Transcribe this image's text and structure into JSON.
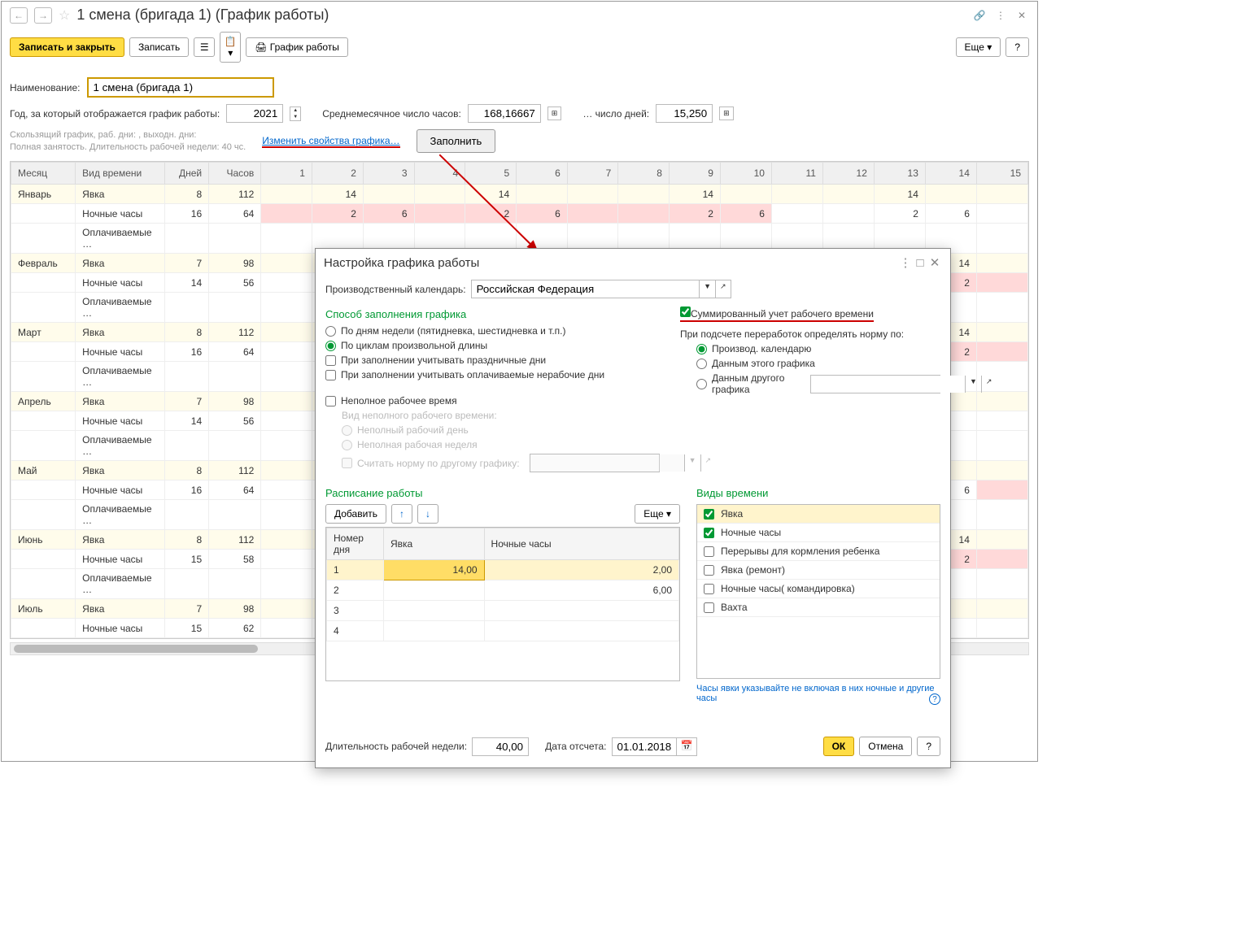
{
  "window": {
    "title": "1 смена (бригада 1) (График работы)",
    "buttons": {
      "save_close": "Записать и закрыть",
      "save": "Записать",
      "schedule": "График работы",
      "more": "Еще",
      "help": "?"
    }
  },
  "form": {
    "name_label": "Наименование:",
    "name_value": "1 смена (бригада 1)",
    "year_label": "Год, за который отображается график работы:",
    "year_value": "2021",
    "avg_hours_label": "Среднемесячное число часов:",
    "avg_hours_value": "168,16667",
    "avg_days_label": "… число дней:",
    "avg_days_value": "15,250",
    "info_line1": "Скользящий график, раб. дни: , выходн. дни:",
    "info_line2": "Полная занятость. Длительность рабочей недели: 40 чс.",
    "change_link": "Изменить свойства графика…",
    "fill_btn": "Заполнить"
  },
  "table": {
    "headers": {
      "month": "Месяц",
      "vid": "Вид времени",
      "dney": "Дней",
      "chasov": "Часов"
    },
    "days": [
      "1",
      "2",
      "3",
      "4",
      "5",
      "6",
      "7",
      "8",
      "9",
      "10",
      "11",
      "12",
      "13",
      "14",
      "15"
    ],
    "rows": [
      {
        "month": "Январь",
        "vid": "Явка",
        "dney": "8",
        "chasov": "112",
        "cells": {
          "2": "14",
          "5": "14",
          "9": "14",
          "13": "14"
        },
        "yellow": [
          "1",
          "2",
          "3",
          "4",
          "5",
          "6",
          "7",
          "8",
          "9",
          "10",
          "15"
        ],
        "isMonth": true,
        "pink": []
      },
      {
        "month": "",
        "vid": "Ночные часы",
        "dney": "16",
        "chasov": "64",
        "cells": {
          "2": "2",
          "3": "6",
          "5": "2",
          "6": "6",
          "9": "2",
          "10": "6",
          "13": "2",
          "14": "6"
        },
        "pink": [
          "1",
          "2",
          "3",
          "4",
          "5",
          "6",
          "7",
          "8",
          "9",
          "10"
        ],
        "yellow": []
      },
      {
        "month": "",
        "vid": "Оплачиваемые …",
        "dney": "",
        "chasov": "",
        "cells": {},
        "pink": [],
        "yellow": []
      },
      {
        "month": "Февраль",
        "vid": "Явка",
        "dney": "7",
        "chasov": "98",
        "cells": {
          "14": "14"
        },
        "yellow": [
          "14",
          "15"
        ],
        "isMonth": true,
        "pink": []
      },
      {
        "month": "",
        "vid": "Ночные часы",
        "dney": "14",
        "chasov": "56",
        "cells": {
          "14": "2"
        },
        "pink": [
          "14",
          "15"
        ],
        "yellow": []
      },
      {
        "month": "",
        "vid": "Оплачиваемые …",
        "dney": "",
        "chasov": "",
        "cells": {},
        "pink": [],
        "yellow": []
      },
      {
        "month": "Март",
        "vid": "Явка",
        "dney": "8",
        "chasov": "112",
        "cells": {
          "14": "14"
        },
        "yellow": [
          "14",
          "15"
        ],
        "isMonth": true,
        "pink": []
      },
      {
        "month": "",
        "vid": "Ночные часы",
        "dney": "16",
        "chasov": "64",
        "cells": {
          "14": "2"
        },
        "pink": [
          "14",
          "15"
        ],
        "yellow": []
      },
      {
        "month": "",
        "vid": "Оплачиваемые …",
        "dney": "",
        "chasov": "",
        "cells": {},
        "pink": [],
        "yellow": []
      },
      {
        "month": "Апрель",
        "vid": "Явка",
        "dney": "7",
        "chasov": "98",
        "cells": {},
        "yellow": [],
        "isMonth": true,
        "pink": []
      },
      {
        "month": "",
        "vid": "Ночные часы",
        "dney": "14",
        "chasov": "56",
        "cells": {},
        "pink": [],
        "yellow": []
      },
      {
        "month": "",
        "vid": "Оплачиваемые …",
        "dney": "",
        "chasov": "",
        "cells": {},
        "pink": [],
        "yellow": []
      },
      {
        "month": "Май",
        "vid": "Явка",
        "dney": "8",
        "chasov": "112",
        "cells": {},
        "yellow": [
          "15"
        ],
        "isMonth": true,
        "pink": []
      },
      {
        "month": "",
        "vid": "Ночные часы",
        "dney": "16",
        "chasov": "64",
        "cells": {
          "14": "6"
        },
        "pink": [
          "15"
        ],
        "yellow": []
      },
      {
        "month": "",
        "vid": "Оплачиваемые …",
        "dney": "",
        "chasov": "",
        "cells": {},
        "pink": [],
        "yellow": []
      },
      {
        "month": "Июнь",
        "vid": "Явка",
        "dney": "8",
        "chasov": "112",
        "cells": {
          "14": "14"
        },
        "yellow": [
          "14",
          "15"
        ],
        "isMonth": true,
        "pink": []
      },
      {
        "month": "",
        "vid": "Ночные часы",
        "dney": "15",
        "chasov": "58",
        "cells": {
          "14": "2"
        },
        "pink": [
          "14",
          "15"
        ],
        "yellow": []
      },
      {
        "month": "",
        "vid": "Оплачиваемые …",
        "dney": "",
        "chasov": "",
        "cells": {},
        "pink": [],
        "yellow": []
      },
      {
        "month": "Июль",
        "vid": "Явка",
        "dney": "7",
        "chasov": "98",
        "cells": {},
        "yellow": [],
        "isMonth": true,
        "pink": []
      },
      {
        "month": "",
        "vid": "Ночные часы",
        "dney": "15",
        "chasov": "62",
        "cells": {},
        "pink": [],
        "yellow": []
      }
    ]
  },
  "dialog": {
    "title": "Настройка графика работы",
    "calendar_label": "Производственный календарь:",
    "calendar_value": "Российская Федерация",
    "fill_method_title": "Способ заполнения графика",
    "radio_by_week": "По дням недели (пятидневка, шестидневка и т.п.)",
    "radio_by_cycle": "По циклам произвольной длины",
    "check_holidays": "При заполнении учитывать праздничные дни",
    "check_paid_nonwork": "При заполнении учитывать оплачиваемые нерабочие дни",
    "check_sum": "Суммированный учет рабочего времени",
    "norm_label": "При подсчете переработок определять норму по:",
    "radio_prod_cal": "Производ. календарю",
    "radio_this_sched": "Данным этого графика",
    "radio_other_sched": "Данным другого графика",
    "check_parttime": "Неполное рабочее время",
    "parttime_kind_label": "Вид неполного рабочего времени:",
    "radio_partday": "Неполный рабочий день",
    "radio_partweek": "Неполная рабочая неделя",
    "check_other_norm": "Считать норму по другому графику:",
    "schedule_title": "Расписание работы",
    "types_title": "Виды времени",
    "add_btn": "Добавить",
    "more_btn": "Еще",
    "sched_headers": {
      "num": "Номер дня",
      "yavka": "Явка",
      "night": "Ночные часы"
    },
    "sched_rows": [
      {
        "n": "1",
        "yavka": "14,00",
        "night": "2,00",
        "sel": true
      },
      {
        "n": "2",
        "yavka": "",
        "night": "6,00"
      },
      {
        "n": "3",
        "yavka": "",
        "night": ""
      },
      {
        "n": "4",
        "yavka": "",
        "night": ""
      }
    ],
    "time_types": [
      {
        "label": "Явка",
        "checked": true,
        "sel": true
      },
      {
        "label": "Ночные часы",
        "checked": true
      },
      {
        "label": "Перерывы для кормления ребенка",
        "checked": false
      },
      {
        "label": "Явка (ремонт)",
        "checked": false
      },
      {
        "label": "Ночные часы( командировка)",
        "checked": false
      },
      {
        "label": "Вахта",
        "checked": false
      }
    ],
    "hint": "Часы явки указывайте не включая в них ночные и другие часы",
    "week_len_label": "Длительность рабочей недели:",
    "week_len_value": "40,00",
    "start_date_label": "Дата отсчета:",
    "start_date_value": "01.01.2018",
    "ok": "ОК",
    "cancel": "Отмена",
    "help": "?"
  }
}
